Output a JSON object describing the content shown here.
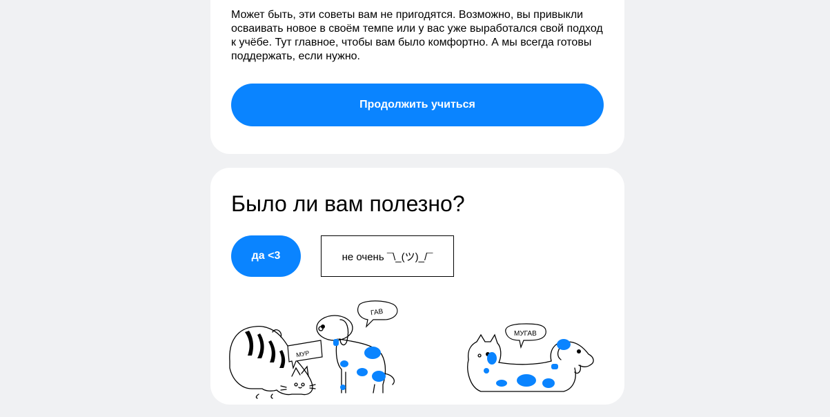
{
  "tips": {
    "text": "Может быть, эти советы вам не пригодятся. Возможно, вы привыкли осваивать новое в своём темпе или у вас уже выработался свой подход к учёбе. Тут главное, чтобы вам было комфортно. А мы всегда готовы поддержать, если нужно.",
    "continue_label": "Продолжить учиться"
  },
  "feedback": {
    "question": "Было ли вам полезно?",
    "yes_label": "да <3",
    "no_label": "не очень ¯\\_(ツ)_/¯"
  },
  "illustration": {
    "cat_bubble": "МУР",
    "dog_bubble": "ГАВ",
    "pair_bubble": "МУГАВ"
  },
  "colors": {
    "accent": "#0a84ff",
    "page_bg": "#f0f1f3",
    "card_bg": "#ffffff"
  }
}
